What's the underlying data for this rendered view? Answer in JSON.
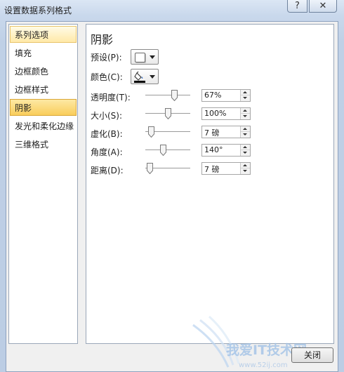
{
  "window": {
    "title": "设置数据系列格式",
    "help_label": "?",
    "close_label": "✕"
  },
  "sidebar": {
    "items": [
      {
        "label": "系列选项",
        "state": "hover"
      },
      {
        "label": "填充",
        "state": "normal"
      },
      {
        "label": "边框颜色",
        "state": "normal"
      },
      {
        "label": "边框样式",
        "state": "normal"
      },
      {
        "label": "阴影",
        "state": "selected"
      },
      {
        "label": "发光和柔化边缘",
        "state": "normal"
      },
      {
        "label": "三维格式",
        "state": "normal"
      }
    ]
  },
  "panel": {
    "title": "阴影",
    "preset": {
      "label": "预设(P):",
      "icon": "shadow-preset-icon"
    },
    "color": {
      "label": "颜色(C):",
      "icon": "paint-bucket-icon",
      "current_color": "#000000"
    },
    "sliders": [
      {
        "label": "透明度(T):",
        "value": "67%",
        "fraction": 0.67
      },
      {
        "label": "大小(S):",
        "value": "100%",
        "fraction": 0.5
      },
      {
        "label": "虚化(B):",
        "value": "7 磅",
        "fraction": 0.07
      },
      {
        "label": "角度(A):",
        "value": "140°",
        "fraction": 0.39
      },
      {
        "label": "距离(D):",
        "value": "7 磅",
        "fraction": 0.035
      }
    ]
  },
  "footer": {
    "close_button": "关闭"
  },
  "watermark": {
    "text": "我爱IT技术网",
    "subtext": "www.52ij.com"
  },
  "colors": {
    "selected_item": "#f9cd5b",
    "hover_item": "#ffe9a8",
    "frame": "#c9d8ec"
  }
}
